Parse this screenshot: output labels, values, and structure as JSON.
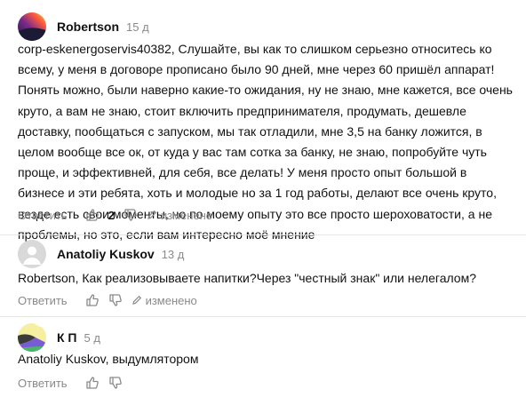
{
  "comments": [
    {
      "author": "Robertson",
      "time": "15 д",
      "text": "corp-eskenergoservis40382, Слушайте, вы как то слишком серьезно относитесь ко всему, у меня в договоре прописано было 90 дней, мне через 60 пришёл аппарат! Понять можно, были наверно какие-то ожидания, ну не знаю, мне кажется, все очень круто, а вам не знаю, стоит включить предпринимателя, продумать, дешевле доставку, пообщаться с запуском, мы так отладили, мне 3,5 на банку ложится, в целом вообще все ок, от куда у вас там сотка за банку, не знаю, попробуйте чуть проще, и эффективней, для себя, все делать! У меня просто опыт большой в бизнесе и эти ребята, хоть и молодые но за 1 год работы, делают все очень круто, везде есть свои моменты, но по моему опыту это все просто шероховатости, а не проблемы, но это, если вам интересно моё мнение",
      "reply_label": "Ответить",
      "score": "2",
      "edited_label": "изменено",
      "avatar_icon": "gradient-avatar-icon"
    },
    {
      "author": "Anatoliy Kuskov",
      "time": "13 д",
      "text": "Robertson, Как реализовываете напитки?Через \"честный знак\" или нелегалом?",
      "reply_label": "Ответить",
      "score": "",
      "edited_label": "изменено",
      "avatar_icon": "default-user-avatar-icon"
    },
    {
      "author": "К П",
      "time": "5 д",
      "text": "Anatoliy Kuskov, выдумлятором",
      "reply_label": "Ответить",
      "score": "",
      "edited_label": "",
      "avatar_icon": "colorful-avatar-icon"
    }
  ],
  "colors": {
    "text": "#111111",
    "muted": "#8a8a8a",
    "divider": "#e6e6e6"
  }
}
